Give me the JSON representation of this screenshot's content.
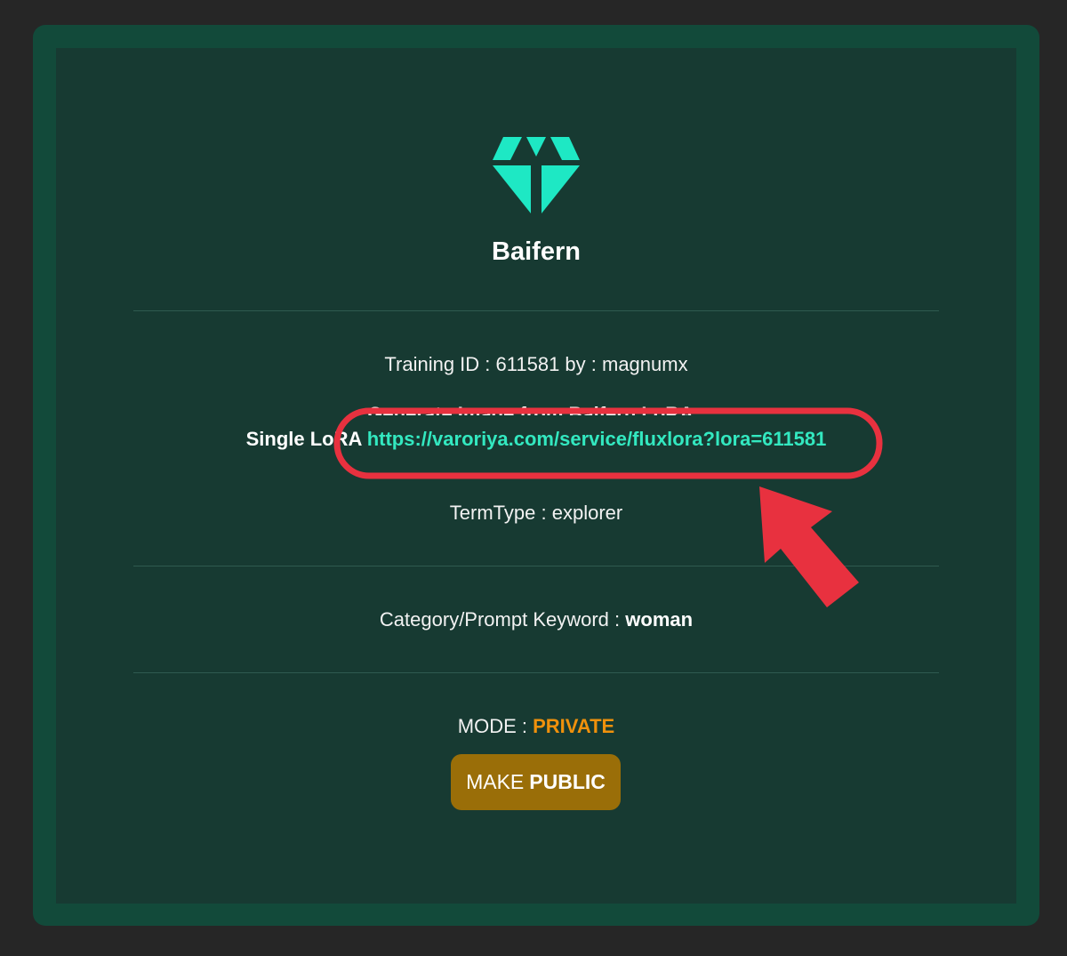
{
  "training": {
    "name": "Baifern",
    "id_label": "Training ID : ",
    "id": "611581",
    "by_label": " by : ",
    "user": "magnumx"
  },
  "generate": {
    "label": "Generate Image from Baifern LoRA :",
    "single_prefix": "Single LoRA",
    "url": "https://varoriya.com/service/fluxlora?lora=611581"
  },
  "term": {
    "label": "TermType : ",
    "value": "explorer"
  },
  "category": {
    "label": "Category/Prompt Keyword : ",
    "value": "woman"
  },
  "mode": {
    "label": "MODE : ",
    "value": "PRIVATE",
    "button_prefix": "MAKE",
    "button_strong": "PUBLIC"
  },
  "colors": {
    "accent": "#1ee8c4",
    "private": "#f0910c",
    "button": "#9a6e08",
    "annotation": "#e8313f"
  },
  "icons": {
    "logo": "diamond-icon",
    "annotation_arrow": "arrow-icon"
  }
}
